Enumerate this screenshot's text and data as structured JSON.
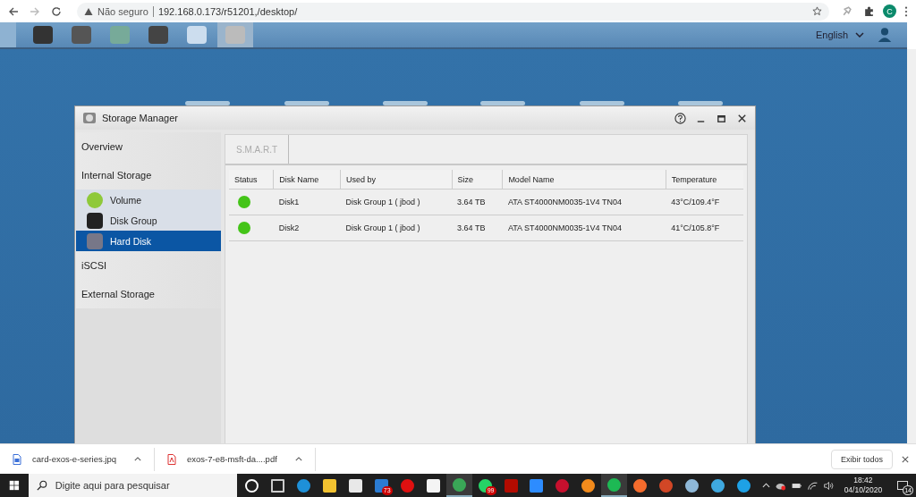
{
  "browser": {
    "security": "Não seguro",
    "url": "192.168.0.173/r51201,/desktop/",
    "profile_initial": "C"
  },
  "nas_bar": {
    "apps": [
      {
        "kind": "files",
        "selected": false
      },
      {
        "kind": "photo",
        "selected": false
      },
      {
        "kind": "music",
        "selected": false
      },
      {
        "kind": "video",
        "selected": false
      },
      {
        "kind": "cloud",
        "selected": false
      },
      {
        "kind": "disk",
        "selected": true
      }
    ],
    "language": "English"
  },
  "window": {
    "title": "Storage Manager",
    "sidebar": [
      {
        "label": "Overview",
        "selected": false
      },
      {
        "label": "Internal Storage",
        "selected": false,
        "expanded": true,
        "children": [
          {
            "label": "Volume",
            "kind": "volume",
            "selected": false
          },
          {
            "label": "Disk Group",
            "kind": "group",
            "selected": false
          },
          {
            "label": "Hard Disk",
            "kind": "disk",
            "selected": true
          }
        ]
      },
      {
        "label": "iSCSI",
        "selected": false
      },
      {
        "label": "External Storage",
        "selected": false
      }
    ],
    "toolbar": [
      {
        "label": "S.M.A.R.T",
        "disabled": true
      }
    ],
    "table": {
      "columns": [
        "Status",
        "Disk Name",
        "Used by",
        "Size",
        "Model Name",
        "Temperature"
      ],
      "rows": [
        {
          "color": "#44c418",
          "cells": [
            "",
            "Disk1",
            "Disk Group 1 ( jbod )",
            "3.64 TB",
            "ATA ST4000NM0035-1V4 TN04",
            "43°C/109.4°F"
          ]
        },
        {
          "color": "#44c418",
          "cells": [
            "",
            "Disk2",
            "Disk Group 1 ( jbod )",
            "3.64 TB",
            "ATA ST4000NM0035-1V4 TN04",
            "41°C/105.8°F"
          ]
        }
      ]
    }
  },
  "downloads": {
    "files": [
      {
        "name": "card-exos-e-series.jpq",
        "kind": "image"
      },
      {
        "name": "exos-7-e8-msft-da....pdf",
        "kind": "pdf"
      }
    ],
    "show_all": "Exibir todos"
  },
  "taskbar": {
    "search_placeholder": "Digite aqui para pesquisar",
    "apps": [
      {
        "kind": "cortana",
        "selected": false
      },
      {
        "kind": "taskview",
        "selected": false
      },
      {
        "kind": "edge",
        "selected": false
      },
      {
        "kind": "folder",
        "selected": false
      },
      {
        "kind": "store",
        "selected": false
      },
      {
        "kind": "mail",
        "selected": false,
        "badge": "73"
      },
      {
        "kind": "opera",
        "selected": false
      },
      {
        "kind": "file",
        "selected": false
      },
      {
        "kind": "chrome",
        "selected": true
      },
      {
        "kind": "whatsapp",
        "selected": false,
        "badge": "99"
      },
      {
        "kind": "acrobat",
        "selected": false
      },
      {
        "kind": "zoom",
        "selected": false
      },
      {
        "kind": "red",
        "selected": false
      },
      {
        "kind": "brave",
        "selected": false
      },
      {
        "kind": "spotify",
        "selected": true
      },
      {
        "kind": "origin",
        "selected": false
      },
      {
        "kind": "powerpoint",
        "selected": false
      },
      {
        "kind": "paint",
        "selected": false
      },
      {
        "kind": "search",
        "selected": false
      },
      {
        "kind": "ie",
        "selected": false
      }
    ],
    "time": "18:42",
    "date": "04/10/2020",
    "notifications": "14"
  }
}
